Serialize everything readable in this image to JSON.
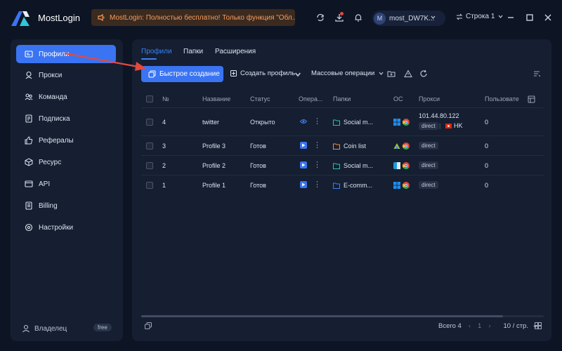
{
  "app": {
    "name": "MostLogin",
    "notice": "MostLogin: Полностью бесплатно! Только функция \"Обл...",
    "user": {
      "avatar_letter": "M",
      "name": "most_DW7K..."
    },
    "row_selector": "Строка 1"
  },
  "sidebar": {
    "items": [
      {
        "label": "Профили",
        "icon": "profile-card-icon",
        "active": true
      },
      {
        "label": "Прокси",
        "icon": "proxy-icon"
      },
      {
        "label": "Команда",
        "icon": "team-icon"
      },
      {
        "label": "Подписка",
        "icon": "subscription-icon"
      },
      {
        "label": "Рефералы",
        "icon": "thumb-up-icon"
      },
      {
        "label": "Ресурс",
        "icon": "cube-icon"
      },
      {
        "label": "API",
        "icon": "api-icon"
      },
      {
        "label": "Billing",
        "icon": "billing-icon"
      },
      {
        "label": "Настройки",
        "icon": "gear-icon"
      }
    ],
    "owner": {
      "label": "Владелец",
      "badge": "free"
    }
  },
  "main": {
    "tabs": [
      {
        "label": "Профили",
        "active": true
      },
      {
        "label": "Папки"
      },
      {
        "label": "Расширения"
      }
    ],
    "toolbar": {
      "quick_create": "Быстрое создание",
      "create_profile": "Создать профиль",
      "bulk_ops": "Массовые операции"
    },
    "table": {
      "headers": [
        "№",
        "Название",
        "Статус",
        "Опера...",
        "Папки",
        "ОС",
        "Прокси",
        "Пользовате"
      ],
      "rows": [
        {
          "num": "4",
          "name": "twitter",
          "status": "Открыто",
          "folder": "Social m...",
          "folder_color": "#22c4b0",
          "proxy_ip": "101.44.80.122",
          "proxy_tag": "direct",
          "region": "HK",
          "user": "0",
          "os": [
            "windows",
            "chrome"
          ],
          "open": true
        },
        {
          "num": "3",
          "name": "Profile 3",
          "status": "Готов",
          "folder": "Coin list",
          "folder_color": "#f28a3d",
          "proxy_ip": "",
          "proxy_tag": "direct",
          "region": "",
          "user": "0",
          "os": [
            "android",
            "chrome"
          ],
          "open": false
        },
        {
          "num": "2",
          "name": "Profile 2",
          "status": "Готов",
          "folder": "Social m...",
          "folder_color": "#22c4b0",
          "proxy_ip": "",
          "proxy_tag": "direct",
          "region": "",
          "user": "0",
          "os": [
            "windows",
            "chrome"
          ],
          "open": false
        },
        {
          "num": "1",
          "name": "Profile 1",
          "status": "Готов",
          "folder": "E-comm...",
          "folder_color": "#3a80f7",
          "proxy_ip": "",
          "proxy_tag": "direct",
          "region": "",
          "user": "0",
          "os": [
            "windows",
            "chrome"
          ],
          "open": false
        }
      ]
    },
    "footer": {
      "total": "Всего 4",
      "page": "1",
      "per_page": "10 / стр."
    }
  },
  "colors": {
    "accent": "#3a74f2",
    "notice_text": "#f49d5f",
    "background": "#0d1524",
    "panel": "#151f31"
  }
}
